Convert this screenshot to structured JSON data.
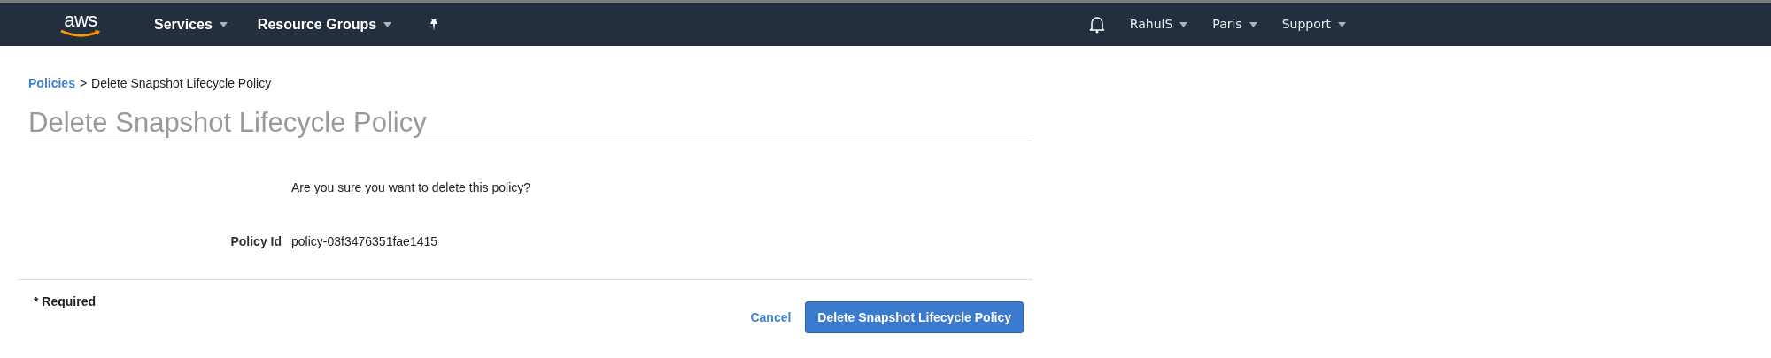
{
  "navbar": {
    "logo": "aws",
    "menus": [
      {
        "label": "Services"
      },
      {
        "label": "Resource Groups"
      }
    ],
    "right_menus": [
      {
        "label": "RahulS"
      },
      {
        "label": "Paris"
      },
      {
        "label": "Support"
      }
    ]
  },
  "breadcrumb": {
    "link": "Policies",
    "separator": ">",
    "current": "Delete Snapshot Lifecycle Policy"
  },
  "title": "Delete Snapshot Lifecycle Policy",
  "question": "Are you sure you want to delete this policy?",
  "fields": [
    {
      "label": "Policy Id",
      "value": "policy-03f3476351fae1415"
    }
  ],
  "footer": {
    "required_note": "* Required",
    "cancel": "Cancel",
    "submit": "Delete Snapshot Lifecycle Policy"
  }
}
